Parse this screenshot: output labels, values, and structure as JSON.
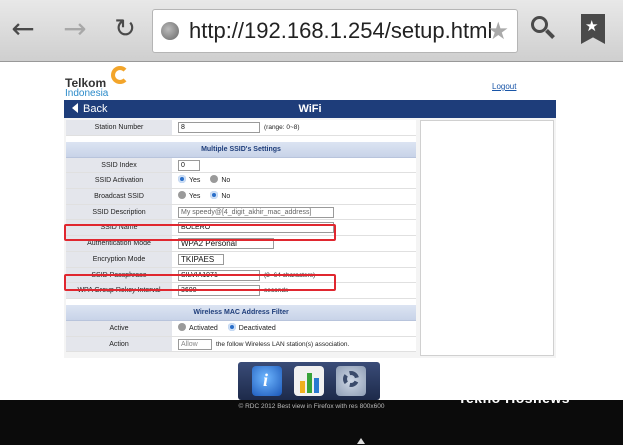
{
  "browser": {
    "url": "http://192.168.1.254/setup.html"
  },
  "header": {
    "logo_brand": "Telkom",
    "logo_sub": "Indonesia",
    "logout": "Logout",
    "back": "Back",
    "title": "WiFi"
  },
  "form": {
    "station_number": {
      "label": "Station Number",
      "value": "8",
      "hint": "(range: 0~8)"
    },
    "multi_ssid_section": "Multiple SSID's Settings",
    "ssid_index": {
      "label": "SSID Index",
      "value": "0"
    },
    "ssid_activation": {
      "label": "SSID Activation",
      "yes": "Yes",
      "no": "No"
    },
    "broadcast_ssid": {
      "label": "Broadcast SSID",
      "yes": "Yes",
      "no": "No"
    },
    "ssid_description": {
      "label": "SSID Description",
      "value": "My speedy@[4_digit_akhir_mac_address]"
    },
    "ssid_name": {
      "label": "SSID Name",
      "value": "BOLERO"
    },
    "auth_mode": {
      "label": "Authentication Mode",
      "value": "WPA2 Personal"
    },
    "encryption_mode": {
      "label": "Encryption Mode",
      "value": "TKIPAES"
    },
    "ssid_passphrase": {
      "label": "SSID Passphrase",
      "value": "SILVIA1971",
      "hint": "(8~64 characters)"
    },
    "wpa_rekey": {
      "label": "WPA Group Rekey Interval",
      "value": "3600",
      "hint": "seconds"
    },
    "mac_filter_section": "Wireless MAC Address Filter",
    "active": {
      "label": "Active",
      "activated": "Activated",
      "deactivated": "Deactivated"
    },
    "action": {
      "label": "Action",
      "value": "Allow",
      "hint": "the follow Wireless LAN station(s) association."
    }
  },
  "footer": {
    "copyright": "© RDC 2012 Best view in Firefox with res 800x600",
    "watermark": "Tekno Hosnews"
  },
  "colors": {
    "title_bar": "#1e3d7a",
    "highlight": "#e0272f",
    "radio_selected": "#2a6fc9"
  },
  "icons": [
    "back-arrow-icon",
    "forward-arrow-icon",
    "reload-icon",
    "globe-icon",
    "star-icon",
    "search-icon",
    "bookmark-icon",
    "info-icon",
    "statistics-icon",
    "settings-gear-icon"
  ]
}
